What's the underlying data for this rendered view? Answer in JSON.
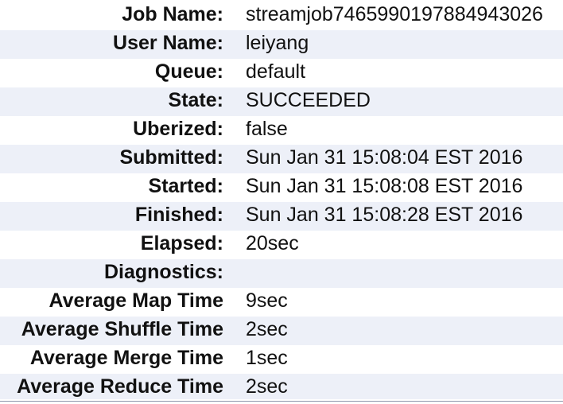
{
  "job_overview": {
    "rows": [
      {
        "label": "Job Name:",
        "value": "streamjob7465990197884943026"
      },
      {
        "label": "User Name:",
        "value": "leiyang"
      },
      {
        "label": "Queue:",
        "value": "default"
      },
      {
        "label": "State:",
        "value": "SUCCEEDED"
      },
      {
        "label": "Uberized:",
        "value": "false"
      },
      {
        "label": "Submitted:",
        "value": "Sun Jan 31 15:08:04 EST 2016"
      },
      {
        "label": "Started:",
        "value": "Sun Jan 31 15:08:08 EST 2016"
      },
      {
        "label": "Finished:",
        "value": "Sun Jan 31 15:08:28 EST 2016"
      },
      {
        "label": "Elapsed:",
        "value": "20sec"
      },
      {
        "label": "Diagnostics:",
        "value": ""
      },
      {
        "label": "Average Map Time",
        "value": "9sec"
      },
      {
        "label": "Average Shuffle Time",
        "value": "2sec"
      },
      {
        "label": "Average Merge Time",
        "value": "1sec"
      },
      {
        "label": "Average Reduce Time",
        "value": "2sec"
      }
    ]
  },
  "colors": {
    "stripe": "#edf0f8",
    "text": "#111111",
    "divider": "#8f97ad"
  }
}
